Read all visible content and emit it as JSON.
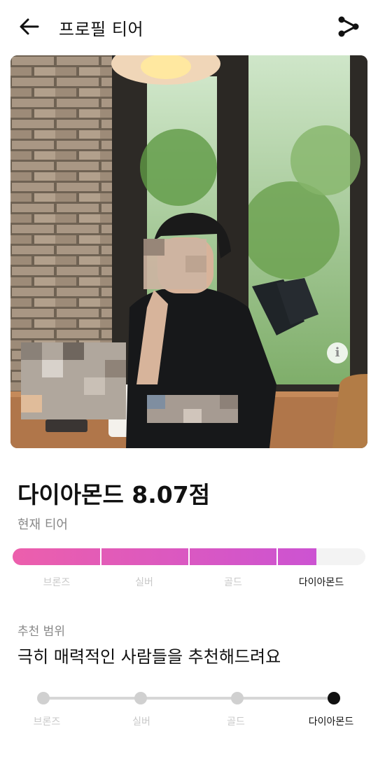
{
  "header": {
    "title": "프로필 티어",
    "back_icon": "arrow-left-icon",
    "share_icon": "share-icon"
  },
  "photo": {
    "info_label": "i"
  },
  "tier": {
    "score_text": "다이아몬드 8.07점",
    "current_label": "현재 티어",
    "progress_fraction": 0.862,
    "bar_colors": [
      "#ec5fac",
      "#cc53d2"
    ],
    "levels": [
      "브론즈",
      "실버",
      "골드",
      "다이아몬드"
    ],
    "active_level": "다이아몬드"
  },
  "recommend": {
    "title": "추천 범위",
    "description": "극히 매력적인 사람들을 추천해드려요",
    "levels": [
      "브론즈",
      "실버",
      "골드",
      "다이아몬드"
    ],
    "active_level": "다이아몬드"
  }
}
